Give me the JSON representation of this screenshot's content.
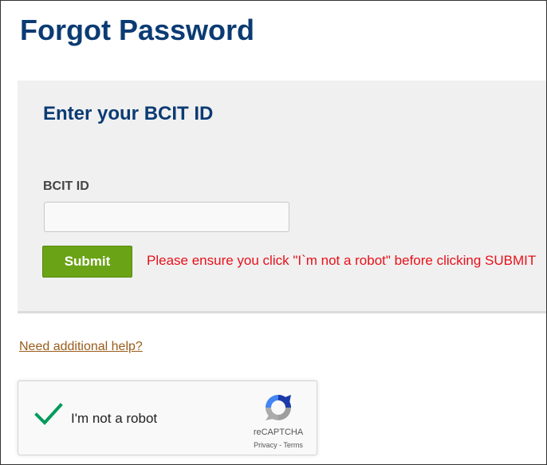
{
  "page": {
    "title": "Forgot Password"
  },
  "form": {
    "heading": "Enter your BCIT ID",
    "id_label": "BCIT ID",
    "id_value": "",
    "submit_label": "Submit",
    "warning": "Please ensure you click \"I`m not a robot\" before clicking SUBMIT",
    "warning_color": "#e8101a"
  },
  "help_link": "Need additional help?",
  "recaptcha": {
    "checked": true,
    "label": "I'm not a robot",
    "brand": "reCAPTCHA",
    "privacy": "Privacy",
    "separator": " - ",
    "terms": "Terms"
  },
  "colors": {
    "title": "#0b3b73",
    "submit_bg": "#6aa316",
    "panel_bg": "#f0f0f0",
    "link": "#9a5c1a",
    "check": "#009b5c"
  },
  "icons": {
    "check": "check-icon",
    "recaptcha_logo": "recaptcha-logo-icon"
  }
}
